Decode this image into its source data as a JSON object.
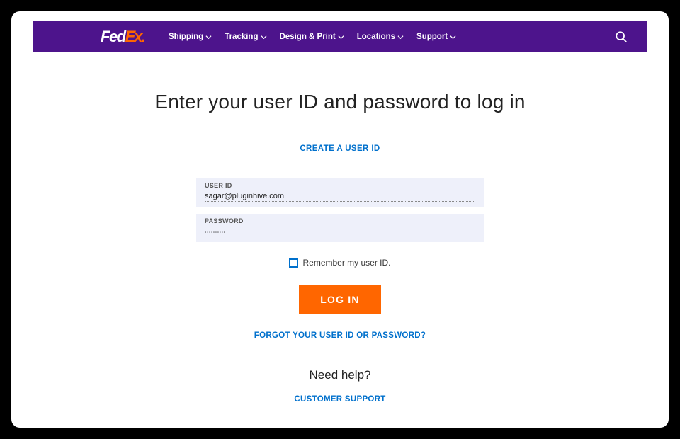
{
  "brand": {
    "part1": "Fed",
    "part2": "Ex",
    "dot": "."
  },
  "nav": {
    "items": [
      {
        "label": "Shipping"
      },
      {
        "label": "Tracking"
      },
      {
        "label": "Design & Print"
      },
      {
        "label": "Locations"
      },
      {
        "label": "Support"
      }
    ]
  },
  "page": {
    "title": "Enter your user ID and password to log in",
    "create_link": "CREATE A USER ID",
    "forgot_link": "FORGOT YOUR USER ID OR PASSWORD?",
    "need_help": "Need help?",
    "support_link": "CUSTOMER SUPPORT"
  },
  "form": {
    "userid_label": "USER ID",
    "userid_value": "sagar@pluginhive.com",
    "password_label": "PASSWORD",
    "password_value": "••••••••••",
    "remember_label": "Remember my user ID.",
    "login_label": "LOG IN"
  }
}
